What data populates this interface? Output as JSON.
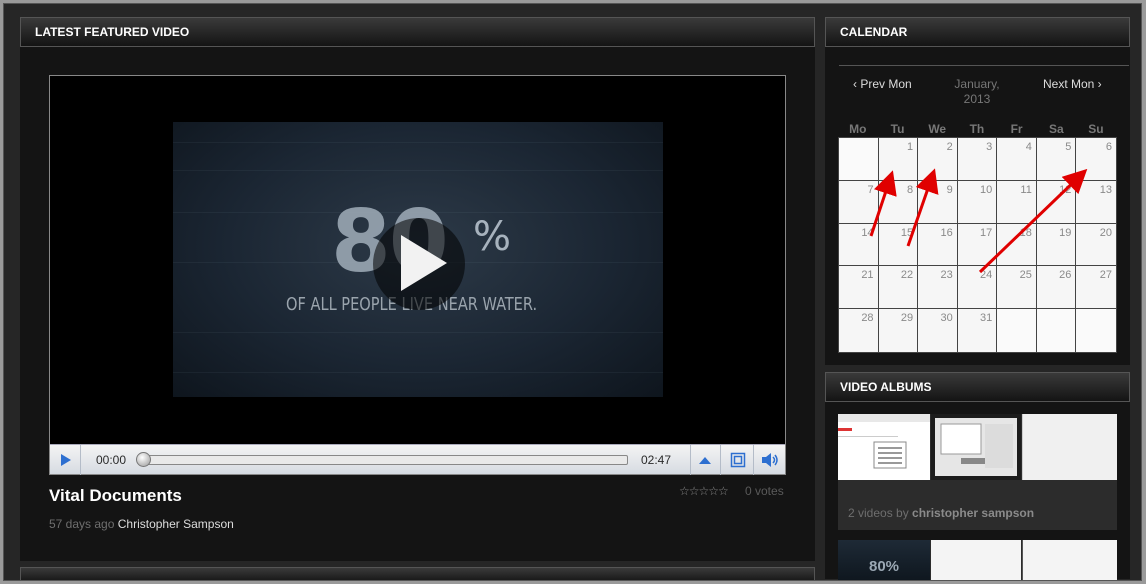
{
  "featured": {
    "header": "LATEST FEATURED VIDEO",
    "video_big_text": "80",
    "video_pct": "%",
    "video_caption": "OF ALL PEOPLE LIVE NEAR WATER.",
    "time_current": "00:00",
    "time_total": "02:47",
    "progress": 0,
    "title": "Vital Documents",
    "age": "57 days ago",
    "author": "Christopher Sampson",
    "stars": "☆☆☆☆☆",
    "votes": "0 votes"
  },
  "calendar": {
    "header": "CALENDAR",
    "prev": "‹ Prev Mon",
    "month": "January, 2013",
    "next": "Next Mon ›",
    "weekdays": [
      "Mo",
      "Tu",
      "We",
      "Th",
      "Fr",
      "Sa",
      "Su"
    ],
    "days": [
      "",
      "1",
      "2",
      "3",
      "4",
      "5",
      "6",
      "7",
      "8",
      "9",
      "10",
      "11",
      "12",
      "13",
      "14",
      "15",
      "16",
      "17",
      "18",
      "19",
      "20",
      "21",
      "22",
      "23",
      "24",
      "25",
      "26",
      "27",
      "28",
      "29",
      "30",
      "31",
      "",
      "",
      ""
    ]
  },
  "albums": {
    "header": "VIDEO ALBUMS",
    "count_label": "2 videos by",
    "owner": "christopher sampson",
    "thumb_text": "80%"
  },
  "annotation_color": "#e00000"
}
